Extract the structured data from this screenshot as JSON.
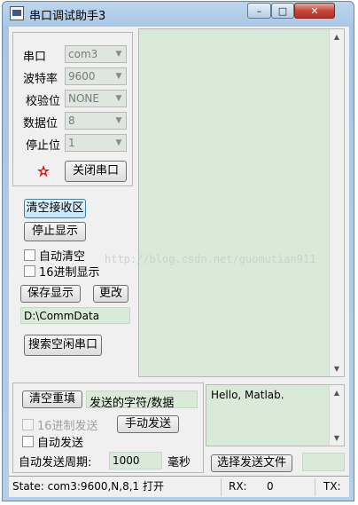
{
  "window": {
    "title": "串口调试助手3",
    "minimize_glyph": "–",
    "maximize_glyph": "□",
    "close_glyph": "✕"
  },
  "settings": {
    "port_label": "串口",
    "port_value": "com3",
    "baud_label": "波特率",
    "baud_value": "9600",
    "parity_label": "校验位",
    "parity_value": "NONE",
    "databits_label": "数据位",
    "databits_value": "8",
    "stopbits_label": "停止位",
    "stopbits_value": "1",
    "indicator_icon": "red-star-indicator-icon",
    "close_port_button": "关闭串口"
  },
  "receive_controls": {
    "clear_receive_button": "清空接收区",
    "stop_display_button": "停止显示",
    "auto_clear_checkbox": "自动清空",
    "hex_display_checkbox": "16进制显示",
    "save_display_button": "保存显示",
    "change_button": "更改",
    "save_path": "D:\\CommData",
    "search_idle_port_button": "搜索空闲串口"
  },
  "send_controls": {
    "clear_refill_button": "清空重填",
    "sent_label": "发送的字符/数据",
    "hex_send_checkbox": "16进制发送",
    "manual_send_button": "手动发送",
    "auto_send_checkbox": "自动发送",
    "period_label": "自动发送周期:",
    "period_value": "1000",
    "period_unit": "毫秒",
    "send_text": "Hello, Matlab.",
    "choose_file_button": "选择发送文件"
  },
  "status": {
    "state": "State: com3:9600,N,8,1 打开",
    "rx_label": "RX:",
    "rx_value": "0",
    "tx_label": "TX:"
  },
  "watermark": "http://blog.csdn.net/guomutian911",
  "colors": {
    "text_area": "#d9ead9",
    "titlebar": "#b5cfe8",
    "close_button": "#c7473a"
  }
}
